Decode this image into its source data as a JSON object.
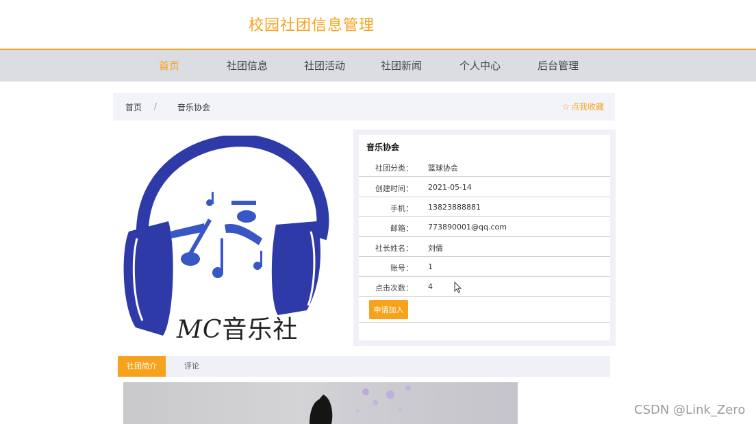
{
  "site": {
    "title": "校园社团信息管理"
  },
  "nav": {
    "items": [
      {
        "label": "首页",
        "active": true
      },
      {
        "label": "社团信息",
        "active": false
      },
      {
        "label": "社团活动",
        "active": false
      },
      {
        "label": "社团新闻",
        "active": false
      },
      {
        "label": "个人中心",
        "active": false
      },
      {
        "label": "后台管理",
        "active": false
      }
    ]
  },
  "breadcrumb": {
    "home": "首页",
    "separator": "/",
    "current": "音乐协会"
  },
  "favorite": {
    "icon": "star-outline-icon",
    "label": "点我收藏"
  },
  "logo": {
    "text_latin": "MC",
    "text_cn": "音乐社",
    "icon": "headphones-music-logo"
  },
  "club": {
    "name": "音乐协会",
    "fields": [
      {
        "label": "社团分类：",
        "value": "篮球协会"
      },
      {
        "label": "创建时间：",
        "value": "2021-05-14"
      },
      {
        "label": "手机：",
        "value": "13823888881"
      },
      {
        "label": "邮箱：",
        "value": "773890001@qq.com"
      },
      {
        "label": "社长姓名：",
        "value": "刘倩"
      },
      {
        "label": "账号：",
        "value": "1"
      },
      {
        "label": "点击次数：",
        "value": "4"
      }
    ],
    "join_label": "申请加入"
  },
  "tabs": [
    {
      "label": "社团简介",
      "active": true
    },
    {
      "label": "评论",
      "active": false
    }
  ],
  "watermark": "CSDN @Link_Zero",
  "colors": {
    "accent": "#f7a21c",
    "nav_bg": "#dcdce3",
    "logo_blue": "#2e3aa8"
  }
}
